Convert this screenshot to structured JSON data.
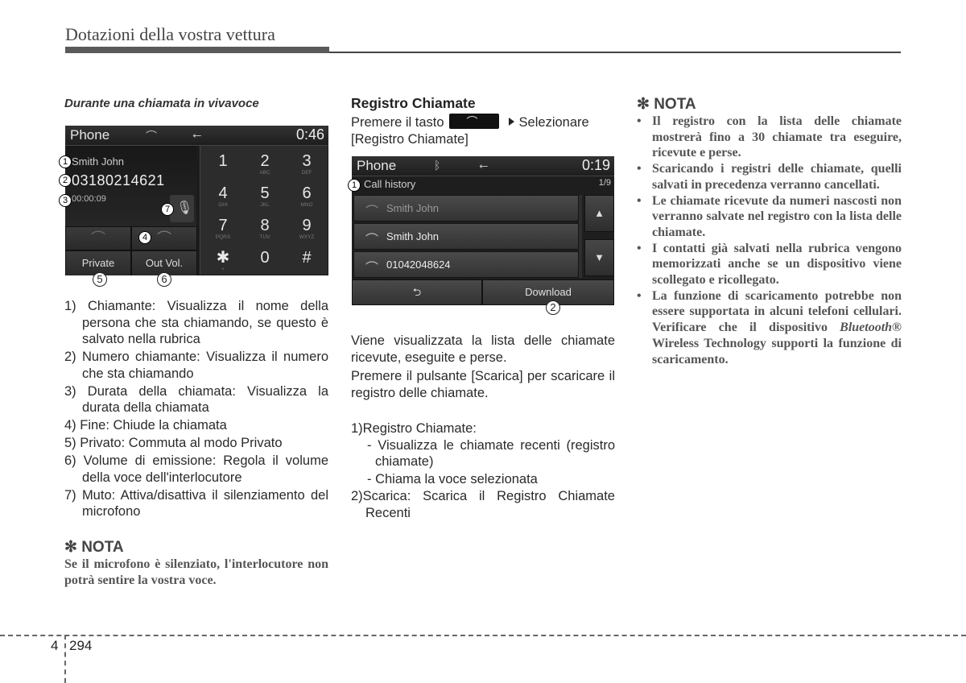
{
  "header": {
    "title": "Dotazioni della vostra vettura"
  },
  "col1": {
    "subtitle": "Durante una chiamata in vivavoce",
    "screen": {
      "title": "Phone",
      "time": "0:46",
      "caller_name": "Smith John",
      "caller_number": "03180214621",
      "duration": "00:00:09",
      "buttons": {
        "private": "Private",
        "out_vol": "Out Vol."
      },
      "keypad": [
        {
          "digit": "1",
          "letters": ""
        },
        {
          "digit": "2",
          "letters": "ABC"
        },
        {
          "digit": "3",
          "letters": "DEF"
        },
        {
          "digit": "4",
          "letters": "GHI"
        },
        {
          "digit": "5",
          "letters": "JKL"
        },
        {
          "digit": "6",
          "letters": "MNO"
        },
        {
          "digit": "7",
          "letters": "PQRS"
        },
        {
          "digit": "8",
          "letters": "TUV"
        },
        {
          "digit": "9",
          "letters": "WXYZ"
        },
        {
          "digit": "✱",
          "letters": "+"
        },
        {
          "digit": "0",
          "letters": ""
        },
        {
          "digit": "#",
          "letters": ""
        }
      ],
      "callouts": [
        "1",
        "2",
        "3",
        "4",
        "5",
        "6",
        "7"
      ],
      "icons": [
        "phone-handset-icon",
        "usb-icon",
        "end-call-icon",
        "mute-mic-icon"
      ]
    },
    "list": [
      "1) Chiamante: Visualizza il nome della persona che sta chiamando, se questo è salvato nella rubrica",
      "2) Numero chiamante: Visualizza il numero che sta chiamando",
      "3) Durata della chiamata: Visualizza la durata della chiamata",
      "4) Fine: Chiude la chiamata",
      "5) Privato: Commuta al modo Privato",
      "6) Volume di emissione: Regola il volume della voce dell'interlocutore",
      "7) Muto: Attiva/disattiva il silenziamento del microfono"
    ],
    "nota": {
      "heading": "✻ NOTA",
      "text": "Se il microfono è silenziato, l'interlocutore non potrà sentire la vostra voce."
    }
  },
  "col2": {
    "subtitle": "Registro Chiamate",
    "instr_before": "Premere il tasto",
    "instr_after": "Selezionare [Registro Chiamate]",
    "screen": {
      "title": "Phone",
      "time": "0:19",
      "section_label": "Call history",
      "page_indicator": "1/9",
      "rows": [
        "Smith John",
        "Smith John",
        "01042048624"
      ],
      "back_label": "⮌",
      "download_label": "Download",
      "callouts": [
        "1",
        "2"
      ]
    },
    "para1": "Viene visualizzata la lista delle chiamate ricevute, eseguite e perse.",
    "para2": "Premere il pulsante [Scarica] per scaricare il registro delle chiamate.",
    "list": {
      "item1": "1)Registro Chiamate:",
      "item1_sub1": "- Visualizza le chiamate recenti (registro chiamate)",
      "item1_sub2": "- Chiama la voce selezionata",
      "item2": "2)Scarica: Scarica il Registro Chiamate Recenti"
    }
  },
  "col3": {
    "nota_heading": "✻ NOTA",
    "bullets": [
      "Il registro con la lista delle chiamate mostrerà fino a 30 chiamate tra eseguire, ricevute e perse.",
      "Scaricando i registri delle chiamate, quelli salvati in precedenza verranno cancellati.",
      "Le chiamate ricevute da numeri nascosti non verranno salvate nel registro con la lista delle chiamate.",
      "I contatti già salvati nella rubrica vengono memorizzati anche se un dispositivo viene scollegato e ricollegato."
    ],
    "bullet5_a": "La funzione di scaricamento potrebbe non essere supportata in alcuni telefoni cellulari. Verificare che il dispositivo ",
    "bullet5_italic": "Bluetooth®",
    "bullet5_b": " Wireless Technology supporti la funzione di scaricamento."
  },
  "footer": {
    "chapter": "4",
    "page": "294"
  }
}
